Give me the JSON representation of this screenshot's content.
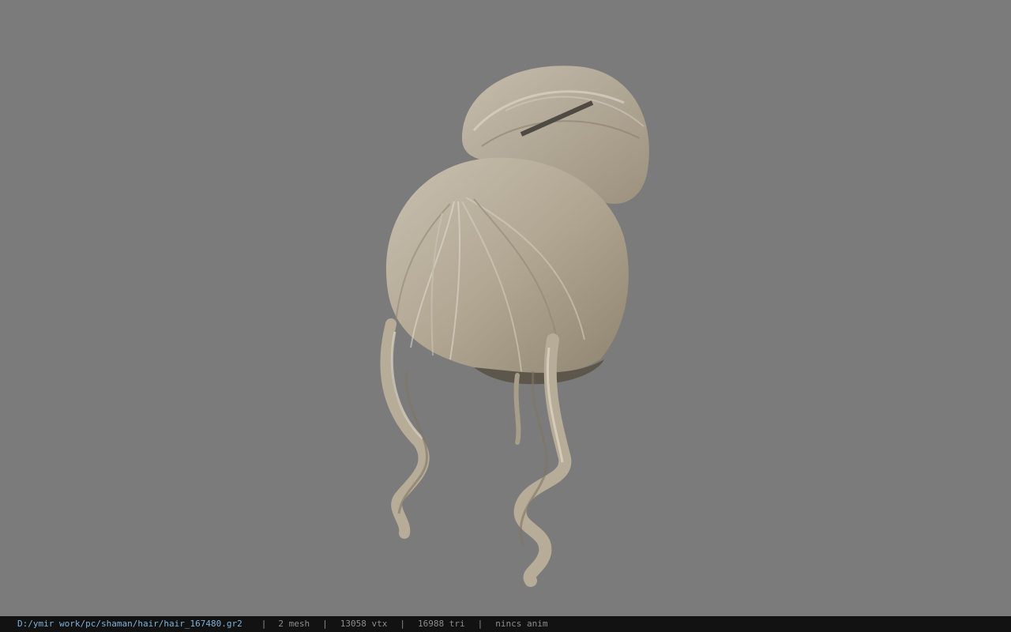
{
  "viewer": {
    "background_color": "#7b7b7b",
    "model": {
      "subject": "hair-model",
      "hair_color": "#b4aa99"
    }
  },
  "statusbar": {
    "file_path": "D:/ymir work/pc/shaman/hair/hair_167480.gr2",
    "separator": "|",
    "mesh_count": "2 mesh",
    "vertex_count": "13058 vtx",
    "triangle_count": "16988 tri",
    "animation": "nincs anim"
  }
}
